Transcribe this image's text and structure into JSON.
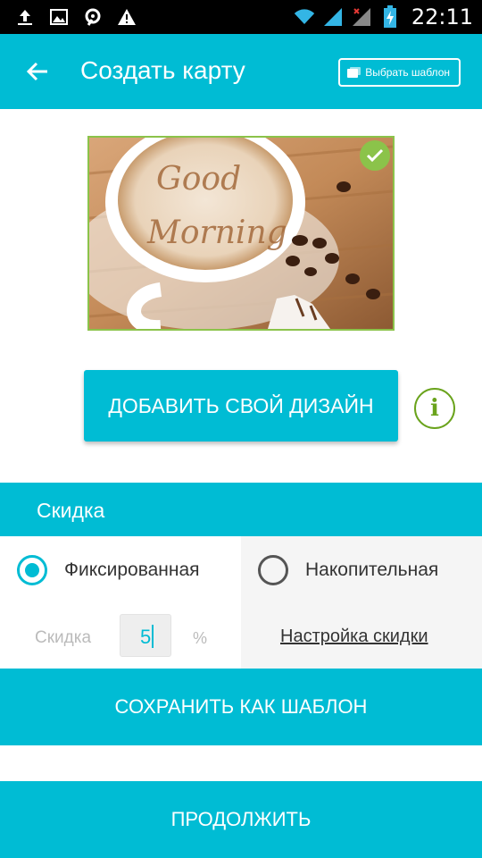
{
  "status_bar": {
    "time": "22:11",
    "left_icons": [
      "upload-icon",
      "image-icon",
      "signal-icon",
      "warning-icon"
    ],
    "right_icons": [
      "wifi-icon",
      "cell-signal-icon",
      "cell-signal-no-data-icon",
      "battery-charging-icon"
    ]
  },
  "toolbar": {
    "title": "Создать карту",
    "template_button": "Выбрать шаблон",
    "background": "#00bcd4"
  },
  "card": {
    "image_text": "Good Morning",
    "selected": true
  },
  "add_design": {
    "label": "ДОБАВИТЬ СВОЙ ДИЗАЙН",
    "info_symbol": "i"
  },
  "discount": {
    "header": "Скидка",
    "option_fixed": "Фиксированная",
    "option_accumulative": "Накопительная",
    "selected_option": "Фиксированная",
    "discount_label": "Скидка",
    "discount_value": "5",
    "percent_symbol": "%",
    "settings_link": "Настройка скидки"
  },
  "buttons": {
    "save_template": "СОХРАНИТЬ КАК ШАБЛОН",
    "continue": "ПРОДОЛЖИТЬ"
  },
  "colors": {
    "accent": "#00bcd4",
    "green": "#8bc34a",
    "info_green": "#6aa31c"
  }
}
